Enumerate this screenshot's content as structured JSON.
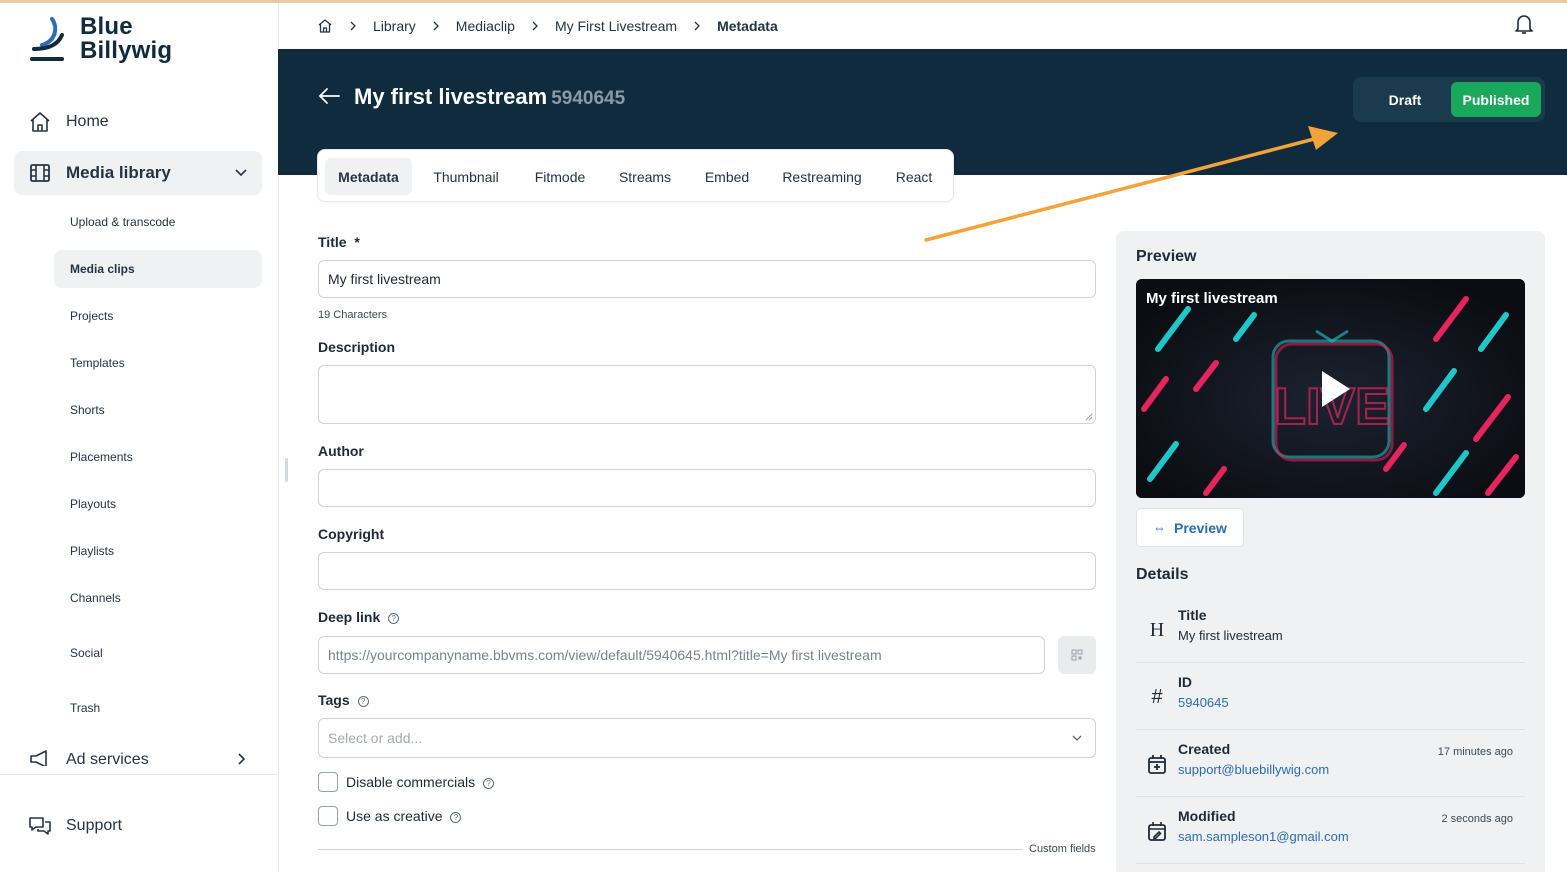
{
  "brand": {
    "line1": "Blue",
    "line2": "Billywig"
  },
  "sidebar": {
    "home": "Home",
    "media_library": "Media library",
    "sub_items": [
      {
        "label": "Upload & transcode"
      },
      {
        "label": "Media clips"
      },
      {
        "label": "Projects"
      },
      {
        "label": "Templates"
      },
      {
        "label": "Shorts"
      },
      {
        "label": "Placements"
      },
      {
        "label": "Playouts"
      },
      {
        "label": "Playlists"
      },
      {
        "label": "Channels"
      },
      {
        "label": "Social"
      },
      {
        "label": "Trash"
      }
    ],
    "ad_services": "Ad services",
    "support": "Support"
  },
  "breadcrumb": {
    "items": [
      "Library",
      "Mediaclip",
      "My First Livestream"
    ],
    "current": "Metadata"
  },
  "header": {
    "title": "My first livestream",
    "id": "5940645",
    "status_draft": "Draft",
    "status_published": "Published"
  },
  "tabs": [
    "Metadata",
    "Thumbnail",
    "Fitmode",
    "Streams",
    "Embed",
    "Restreaming",
    "React"
  ],
  "form": {
    "title_label": "Title",
    "title_required": "*",
    "title_value": "My first livestream",
    "title_hint": "19 Characters",
    "description_label": "Description",
    "author_label": "Author",
    "copyright_label": "Copyright",
    "deeplink_label": "Deep link",
    "deeplink_value": "https://yourcompanyname.bbvms.com/view/default/5940645.html?title=My first livestream",
    "tags_label": "Tags",
    "tags_placeholder": "Select or add...",
    "disable_commercials": "Disable commercials",
    "use_as_creative": "Use as creative",
    "custom_fields": "Custom fields"
  },
  "preview": {
    "heading": "Preview",
    "video_title": "My first livestream",
    "button": "Preview",
    "button_icon": "⇔"
  },
  "details": {
    "heading": "Details",
    "items": [
      {
        "key": "Title",
        "value": "My first livestream",
        "time": "",
        "icon": "H"
      },
      {
        "key": "ID",
        "value": "5940645",
        "time": "",
        "icon": "#"
      },
      {
        "key": "Created",
        "value": "support@bluebillywig.com",
        "time": "17 minutes ago",
        "icon": "calendar-plus"
      },
      {
        "key": "Modified",
        "value": "sam.sampleson1@gmail.com",
        "time": "2 seconds ago",
        "icon": "calendar-edit"
      }
    ]
  },
  "colors": {
    "header_bg": "#0f2b3d",
    "published_green": "#1aa85c",
    "link_blue": "#2a6db5",
    "annotation_arrow": "#f2a33a"
  }
}
